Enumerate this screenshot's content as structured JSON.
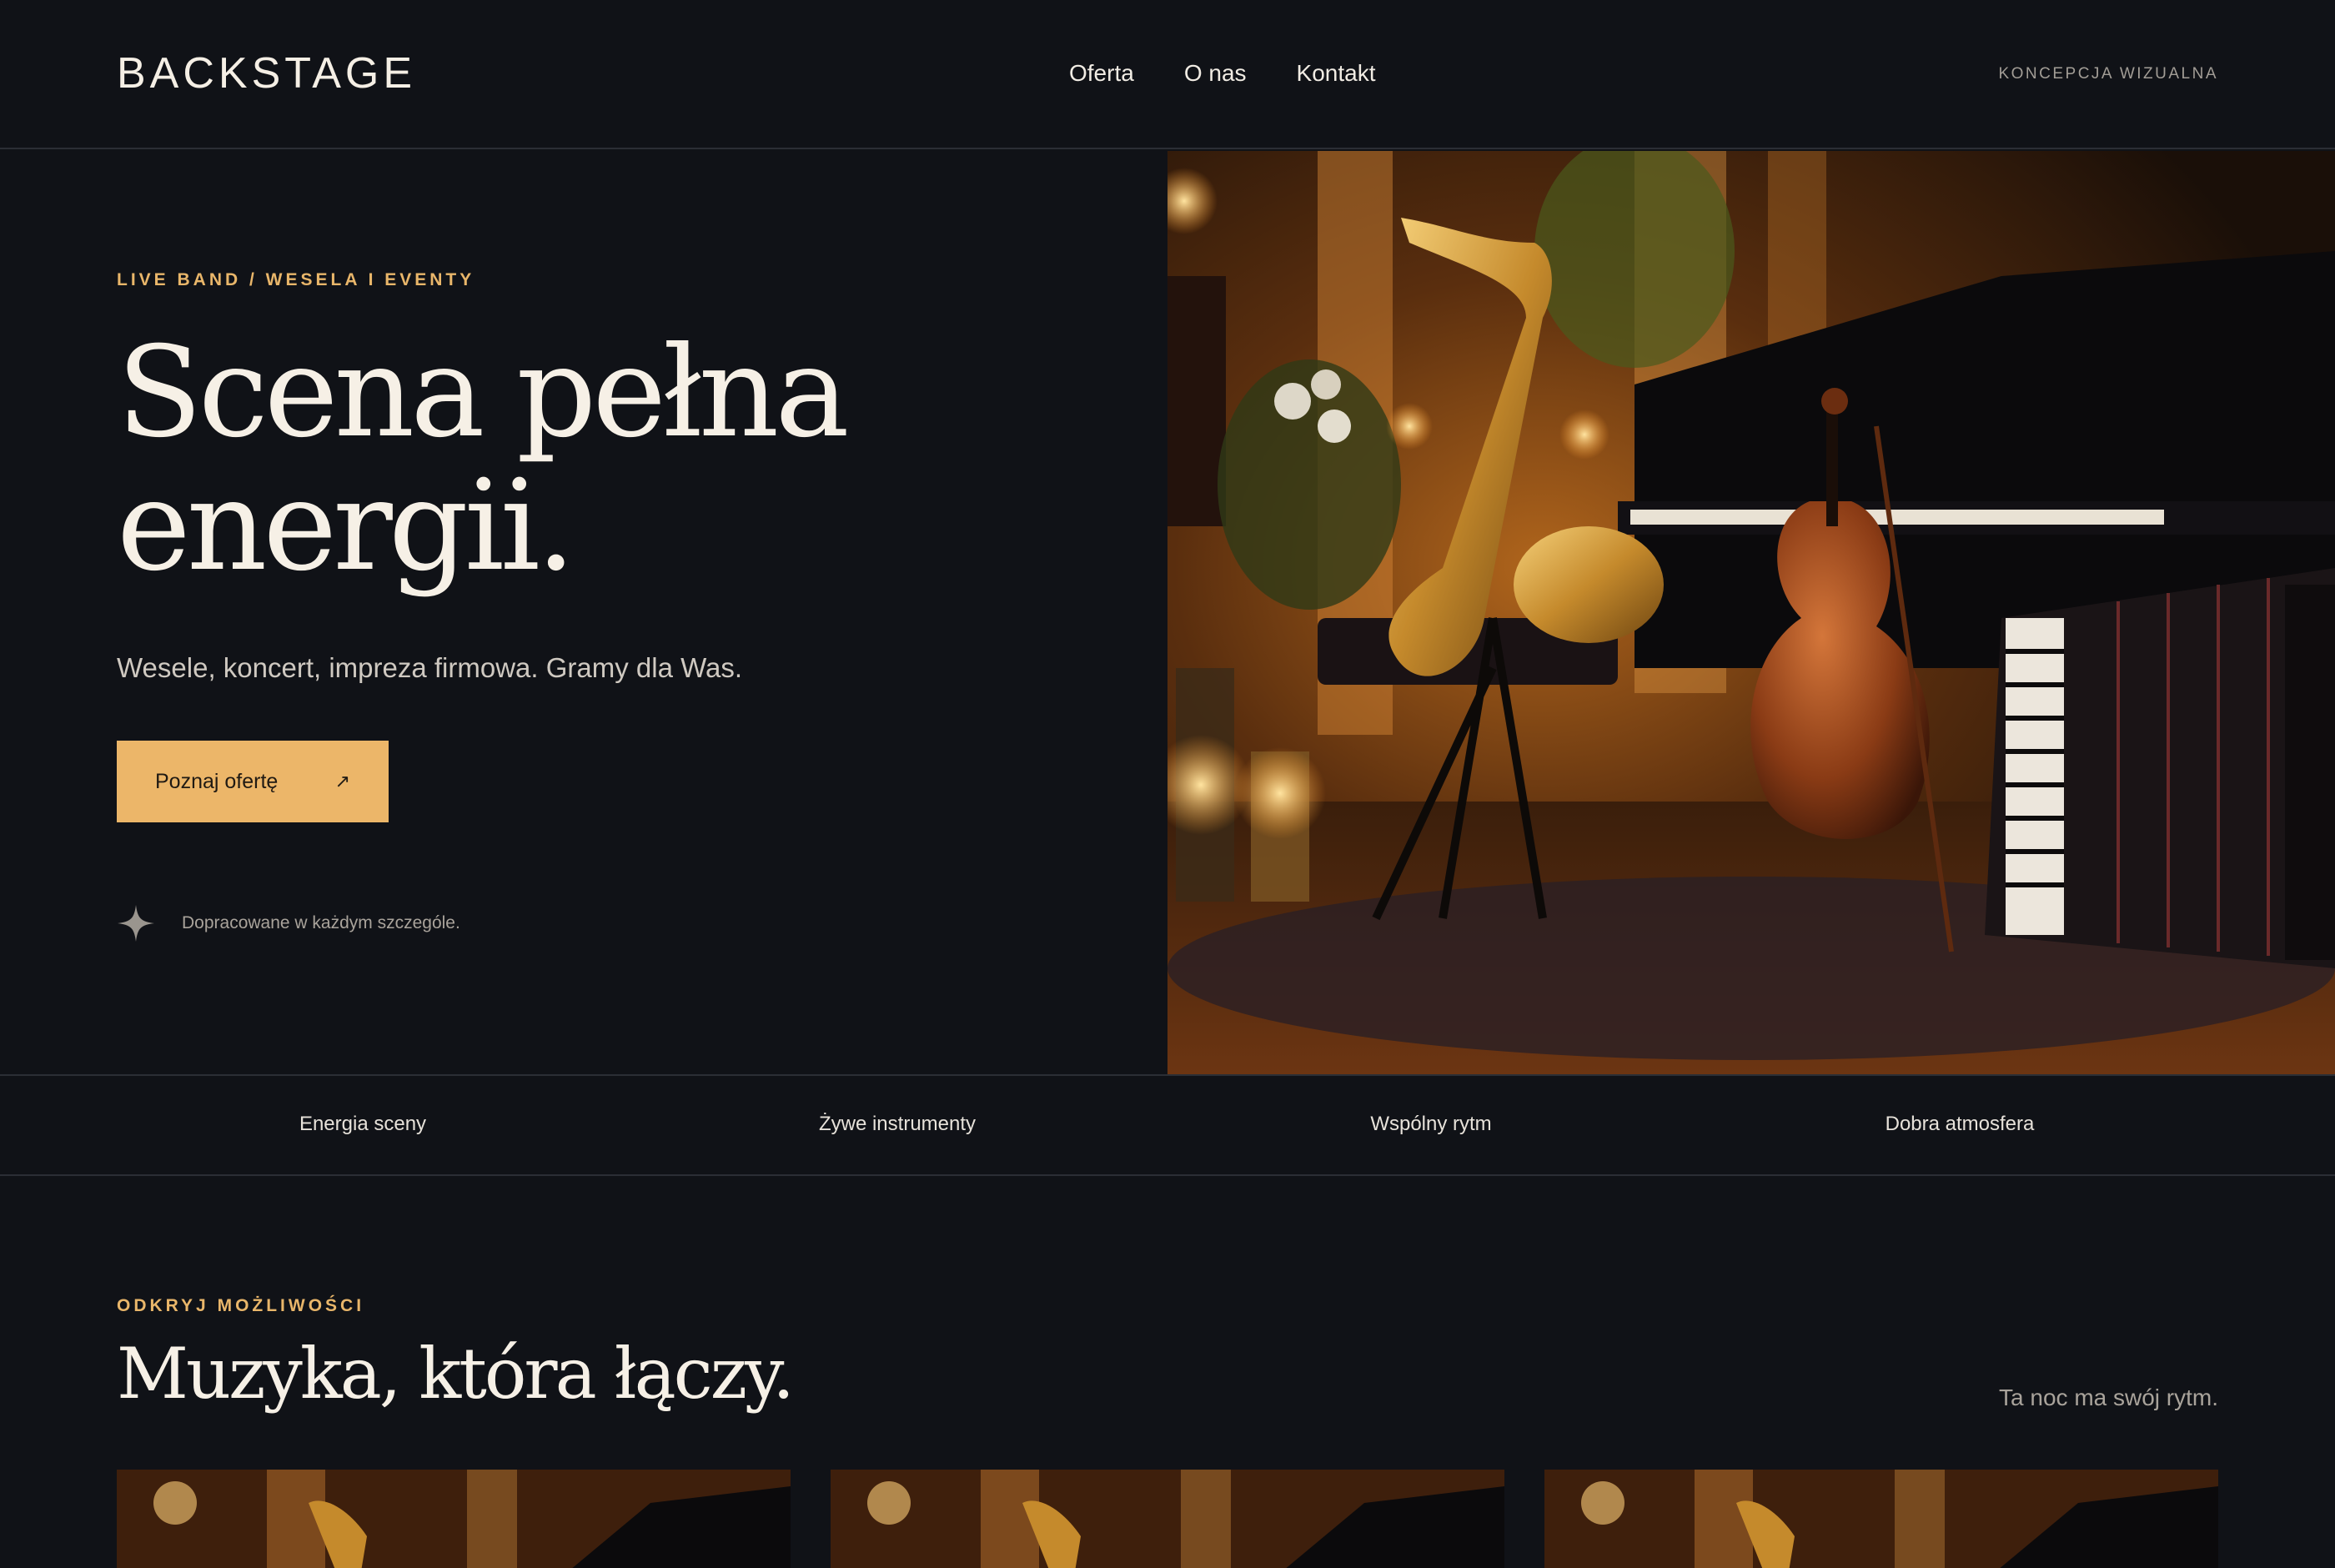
{
  "header": {
    "brand": "BACKSTAGE",
    "nav": [
      "Oferta",
      "O nas",
      "Kontakt"
    ],
    "concept": "KONCEPCJA WIZUALNA"
  },
  "hero": {
    "eyebrow": "LIVE BAND / WESELA I EVENTY",
    "title_line1": "Scena pełna",
    "title_line2": "energii.",
    "subtitle": "Wesele, koncert, impreza firmowa. Gramy dla Was.",
    "cta_label": "Poznaj ofertę",
    "cta_arrow": "↗",
    "quality_note": "Dopracowane w każdym szczególe.",
    "image_subject": "saxophone, violin, accordion and grand piano on a candlelit stage"
  },
  "features": [
    "Energia sceny",
    "Żywe instrumenty",
    "Wspólny rytm",
    "Dobra atmosfera"
  ],
  "section": {
    "eyebrow": "ODKRYJ MOŻLIWOŚCI",
    "title": "Muzyka, która łączy.",
    "note": "Ta noc ma swój rytm.",
    "cards_count": 3
  },
  "colors": {
    "background": "#101217",
    "accent": "#ecb669",
    "text": "#f1ece4",
    "muted": "#a9a39b",
    "divider": "#2b2e35"
  }
}
